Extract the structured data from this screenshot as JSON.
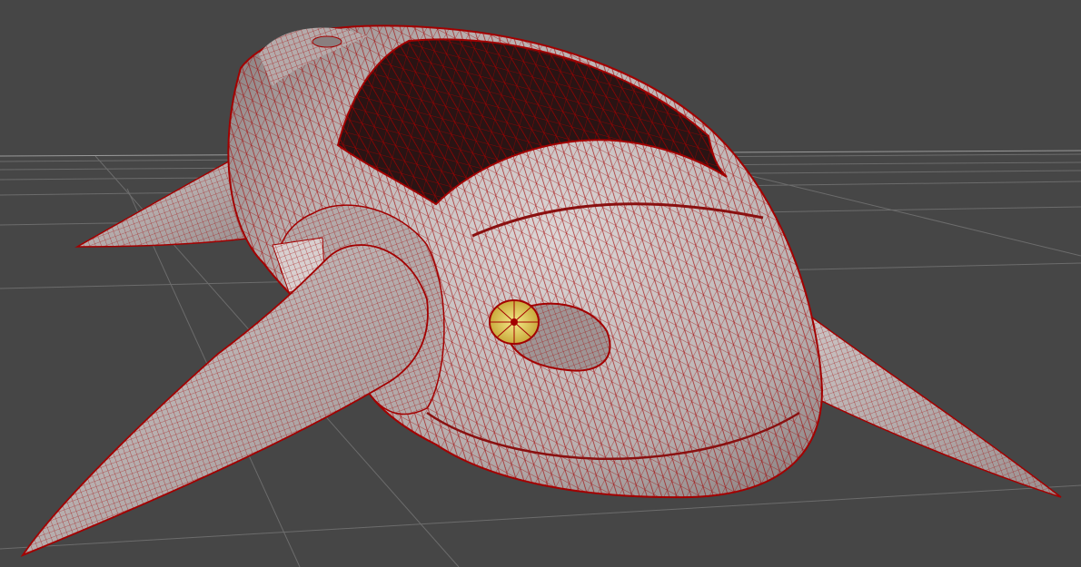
{
  "viewport": {
    "background": "#464646",
    "grid_color": "#6c6c6c",
    "grid_highlight": "#9a9a9a"
  },
  "model": {
    "shell_color": "#c9c2c2",
    "wire_color": "#a30000",
    "canopy_color": "#2a1414",
    "eye_color": "#e8d86a"
  }
}
